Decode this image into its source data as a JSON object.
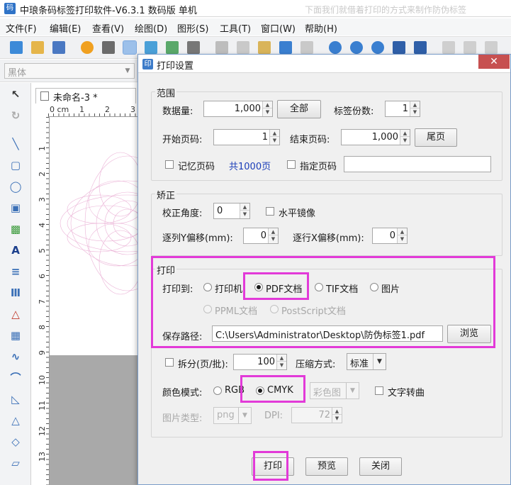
{
  "app": {
    "title": "中琅条码标签打印软件-V6.3.1 数码版 单机",
    "ghost_text": "下面我们就借着打印的方式来制作防伪标签"
  },
  "menu": [
    "文件(F)",
    "编辑(E)",
    "查看(V)",
    "绘图(D)",
    "图形(S)",
    "工具(T)",
    "窗口(W)",
    "帮助(H)"
  ],
  "font_combo": {
    "value": "黑体"
  },
  "document_tab": {
    "label": "未命名-3 *"
  },
  "ruler": {
    "top_ticks": [
      "0 cm",
      "1",
      "2",
      "3"
    ],
    "left_ticks": [
      "1",
      "2",
      "3",
      "4",
      "5",
      "6",
      "7",
      "8",
      "9",
      "10",
      "11",
      "12",
      "13"
    ]
  },
  "dialog": {
    "title": "打印设置",
    "close_glyph": "✕",
    "range": {
      "label": "范围",
      "data_count_label": "数据量:",
      "data_count": "1,000",
      "all_button": "全部",
      "copies_label": "标签份数:",
      "copies": "1",
      "start_page_label": "开始页码:",
      "start_page": "1",
      "end_page_label": "结束页码:",
      "end_page": "1,000",
      "last_page_button": "尾页",
      "remember_page_label": "记忆页码",
      "total_pages": "共1000页",
      "specify_page_label": "指定页码",
      "specify_page_value": ""
    },
    "correction": {
      "label": "矫正",
      "angle_label": "校正角度:",
      "angle": "0",
      "mirror_label": "水平镜像",
      "col_y_label": "逐列Y偏移(mm):",
      "col_y": "0",
      "row_x_label": "逐行X偏移(mm):",
      "row_x": "0"
    },
    "print": {
      "label": "打印",
      "print_to_label": "打印到:",
      "targets": [
        "打印机",
        "PDF文档",
        "TIF文档",
        "图片"
      ],
      "selected_target": "PDF文档",
      "disabled_targets": [
        "PPML文档",
        "PostScript文档"
      ],
      "save_path_label": "保存路径:",
      "save_path": "C:\\Users\\Administrator\\Desktop\\防伪标签1.pdf",
      "browse_button": "浏览"
    },
    "options": {
      "split_label": "拆分(页/批):",
      "split_value": "100",
      "compress_label": "压缩方式:",
      "compress_value": "标准",
      "color_mode_label": "颜色模式:",
      "color_modes": [
        "RGB",
        "CMYK"
      ],
      "selected_color_mode": "CMYK",
      "color_profile_value": "彩色图",
      "text_to_curve_label": "文字转曲",
      "image_type_label": "图片类型:",
      "image_type_value": "png",
      "dpi_label": "DPI:",
      "dpi_value": "72"
    },
    "buttons": {
      "print": "打印",
      "preview": "预览",
      "close": "关闭"
    }
  },
  "colors": {
    "highlight": "#e23ad8",
    "close_button": "#c75050",
    "link_blue": "#1a3db8"
  }
}
